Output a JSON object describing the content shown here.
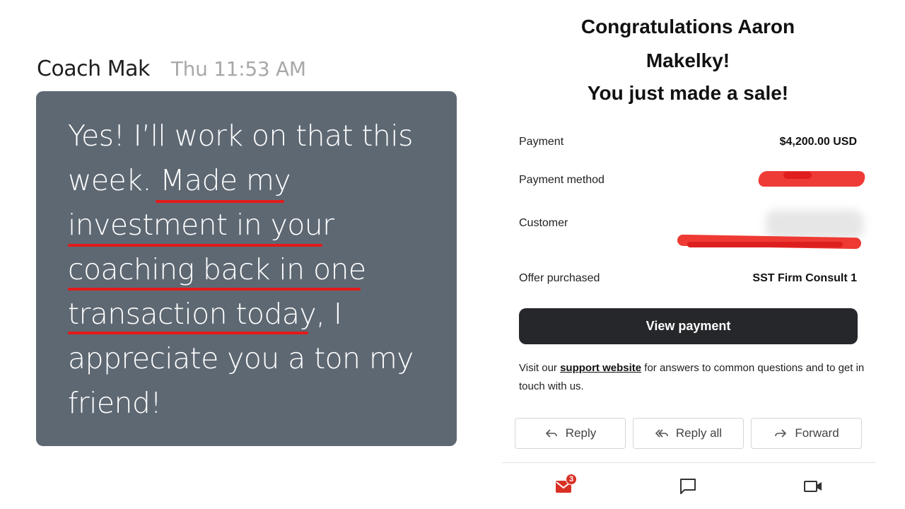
{
  "chat": {
    "sender": "Coach Mak",
    "time": "Thu 11:53 AM",
    "lines": [
      "Yes! I’ll work on that this",
      "week. Made my",
      "investment in your",
      "coaching back in one",
      "transaction today, I",
      "appreciate you a ton my",
      "friend!"
    ],
    "underline_color": "#e31a1a",
    "bubble_color": "#5e6873"
  },
  "email": {
    "headline": [
      "Congratulations Aaron",
      "Makelky!",
      "You just made a sale!"
    ],
    "rows": [
      {
        "label": "Payment",
        "value": "$4,200.00 USD"
      },
      {
        "label": "Payment method",
        "value": ""
      },
      {
        "label": "Customer",
        "value": ""
      },
      {
        "label": "Offer purchased",
        "value": "SST Firm Consult 1"
      }
    ],
    "view_button": "View payment",
    "support_pre": "Visit our ",
    "support_link": "support website",
    "support_post": " for answers to common questions and to get in touch with us.",
    "actions": {
      "reply": "Reply",
      "reply_all": "Reply all",
      "forward": "Forward"
    },
    "nav": {
      "mail_badge": "3",
      "mail_icon": "mail-icon",
      "chat_icon": "chat-icon",
      "video_icon": "video-icon"
    },
    "accent": "#d93025"
  }
}
